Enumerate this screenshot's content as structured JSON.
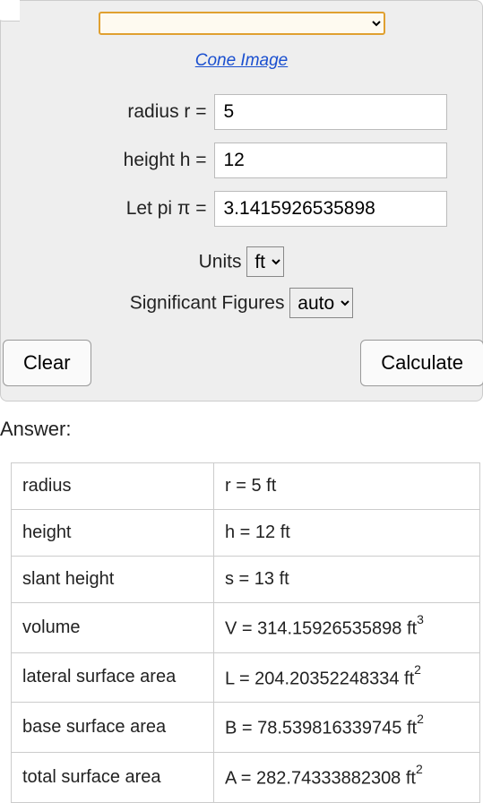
{
  "cone_link": "Cone Image",
  "inputs": {
    "radius": {
      "label": "radius r =",
      "value": "5"
    },
    "height": {
      "label": "height h =",
      "value": "12"
    },
    "pi": {
      "label": "Let pi π =",
      "value": "3.1415926535898"
    }
  },
  "units": {
    "label": "Units",
    "selected": "ft"
  },
  "sigfig": {
    "label": "Significant Figures",
    "selected": "auto"
  },
  "buttons": {
    "clear": "Clear",
    "calculate": "Calculate"
  },
  "answer_label": "Answer:",
  "results": [
    {
      "name": "radius",
      "value": "r = 5 ft",
      "exp": ""
    },
    {
      "name": "height",
      "value": "h = 12 ft",
      "exp": ""
    },
    {
      "name": "slant height",
      "value": "s = 13 ft",
      "exp": ""
    },
    {
      "name": "volume",
      "value": "V = 314.15926535898 ft",
      "exp": "3"
    },
    {
      "name": "lateral surface area",
      "value": "L = 204.20352248334 ft",
      "exp": "2"
    },
    {
      "name": "base surface area",
      "value": "B = 78.539816339745 ft",
      "exp": "2"
    },
    {
      "name": "total surface area",
      "value": "A = 282.74333882308 ft",
      "exp": "2"
    }
  ]
}
